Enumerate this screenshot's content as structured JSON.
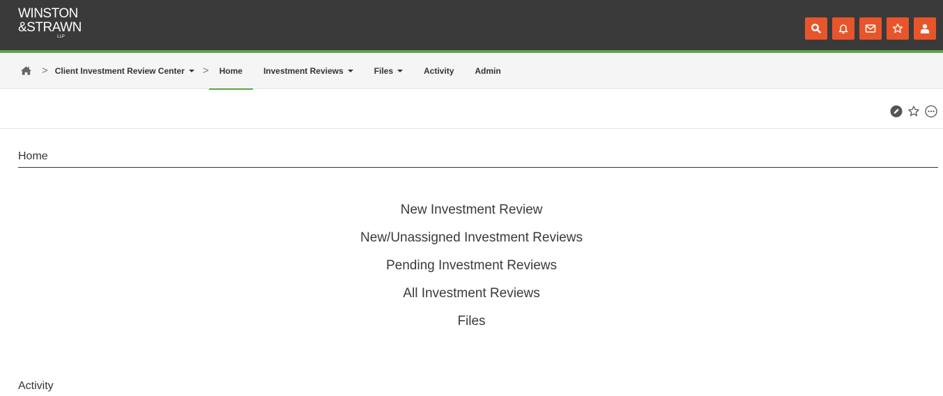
{
  "brand": {
    "line1": "WINSTON",
    "line2": "&STRAWN",
    "line3": "LLP",
    "accent_color": "#e8552b",
    "header_bg": "#3a3a3a",
    "highlight_color": "#5ba443"
  },
  "header_actions": [
    {
      "name": "search-icon"
    },
    {
      "name": "bell-icon"
    },
    {
      "name": "mail-icon"
    },
    {
      "name": "star-icon"
    },
    {
      "name": "user-icon"
    }
  ],
  "nav": {
    "home_icon": "home-icon",
    "site": "Client Investment Review Center",
    "items": [
      {
        "label": "Home",
        "active": true
      },
      {
        "label": "Investment Reviews",
        "dropdown": true
      },
      {
        "label": "Files",
        "dropdown": true
      },
      {
        "label": "Activity"
      },
      {
        "label": "Admin"
      }
    ]
  },
  "page_tools": [
    {
      "name": "edit-icon"
    },
    {
      "name": "star-outline-icon"
    },
    {
      "name": "more-icon"
    }
  ],
  "home": {
    "title": "Home",
    "links": [
      "New Investment Review",
      "New/Unassigned Investment Reviews",
      "Pending Investment Reviews",
      "All Investment Reviews",
      "Files"
    ]
  },
  "activity": {
    "title": "Activity"
  }
}
